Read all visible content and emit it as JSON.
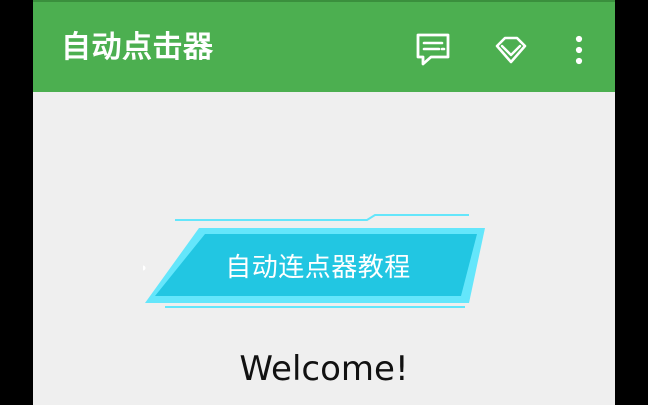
{
  "app": {
    "title": "自动点击器"
  },
  "toolbar": {
    "actions": [
      {
        "icon": "feedback-icon"
      },
      {
        "icon": "diamond-icon"
      },
      {
        "icon": "more-vert-icon"
      }
    ]
  },
  "main": {
    "tutorial_button_label": "自动连点器教程",
    "welcome_text": "Welcome!"
  },
  "colors": {
    "appbar": "#4caf50",
    "background": "#efefef",
    "banner_fill": "#22c6e2",
    "banner_accent": "#64e6fb"
  }
}
